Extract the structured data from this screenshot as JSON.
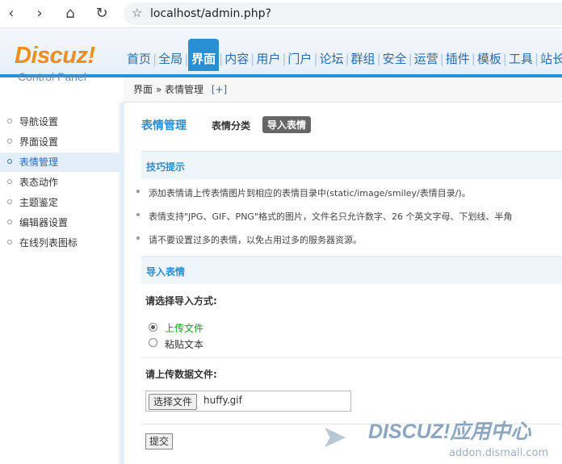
{
  "browser": {
    "back_icon": "back-icon",
    "forward_icon": "forward-icon",
    "home_icon": "home-icon",
    "reload_icon": "reload-icon",
    "url": "localhost/admin.php?"
  },
  "header": {
    "logo": "Discuz!",
    "logo_sub": "Control Panel",
    "nav": [
      "首页",
      "全局",
      "界面",
      "内容",
      "用户",
      "门户",
      "论坛",
      "群组",
      "安全",
      "运营",
      "插件",
      "模板",
      "工具",
      "站长"
    ],
    "active_index": 2
  },
  "breadcrumb": {
    "path": "界面 » 表情管理",
    "add": "[+]"
  },
  "sidebar": {
    "items": [
      "导航设置",
      "界面设置",
      "表情管理",
      "表态动作",
      "主题鉴定",
      "编辑器设置",
      "在线列表图标"
    ],
    "active_index": 2
  },
  "main": {
    "title": "表情管理",
    "tab_category": "表情分类",
    "tab_import": "导入表情",
    "tips_title": "技巧提示",
    "tips": [
      "添加表情请上传表情图片到相应的表情目录中(static/image/smiley/表情目录/)。",
      "表情支持\"JPG、GIF、PNG\"格式的图片，文件名只允许数字、26 个英文字母、下划线、半角",
      "请不要设置过多的表情，以免占用过多的服务器资源。"
    ],
    "import_title": "导入表情",
    "method_label": "请选择导入方式:",
    "option_upload": "上传文件",
    "option_paste": "粘贴文本",
    "file_label": "请上传数据文件:",
    "file_button": "选择文件",
    "file_name": "huffy.gif",
    "submit": "提交"
  },
  "watermark": {
    "brand": "DISCUZ!应用中心",
    "url": "addon.dismall.com"
  },
  "colors": {
    "accent": "#2a8ed3",
    "logo": "#f28c1b",
    "option_active": "#1a9a1a"
  }
}
